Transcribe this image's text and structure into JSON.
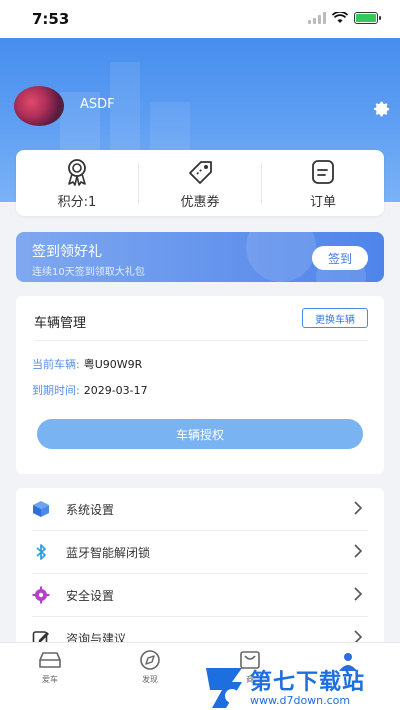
{
  "status": {
    "time": "7:53"
  },
  "profile": {
    "username": "ASDF"
  },
  "quick": {
    "points_label": "积分:1",
    "coupons_label": "优惠券",
    "orders_label": "订单"
  },
  "checkin": {
    "title": "签到领好礼",
    "subtitle": "连续10天签到领取大礼包",
    "button": "签到"
  },
  "vehicle": {
    "title": "车辆管理",
    "switch_label": "更换车辆",
    "current_key": "当前车辆:",
    "current_value": "粤U90W9R",
    "expire_key": "到期时间:",
    "expire_value": "2029-03-17",
    "auth_button": "车辆授权"
  },
  "menu": {
    "items": [
      {
        "label": "系统设置",
        "icon": "cube-icon"
      },
      {
        "label": "蓝牙智能解闭锁",
        "icon": "bluetooth-icon"
      },
      {
        "label": "安全设置",
        "icon": "gear-icon"
      },
      {
        "label": "咨询与建议",
        "icon": "edit-icon"
      }
    ]
  },
  "tabbar": {
    "tabs": [
      {
        "label": "爱车",
        "icon": "car-icon"
      },
      {
        "label": "发现",
        "icon": "compass-icon"
      },
      {
        "label": "商",
        "icon": "bag-icon"
      },
      {
        "label": "",
        "icon": "profile-icon"
      }
    ]
  },
  "watermark": {
    "text": "第七下载站",
    "url": "www.d7down.com"
  },
  "colors": {
    "accent": "#3f7be8",
    "hero": "#3c86ec",
    "button": "#79b3f2",
    "background": "#f2f3f7"
  }
}
